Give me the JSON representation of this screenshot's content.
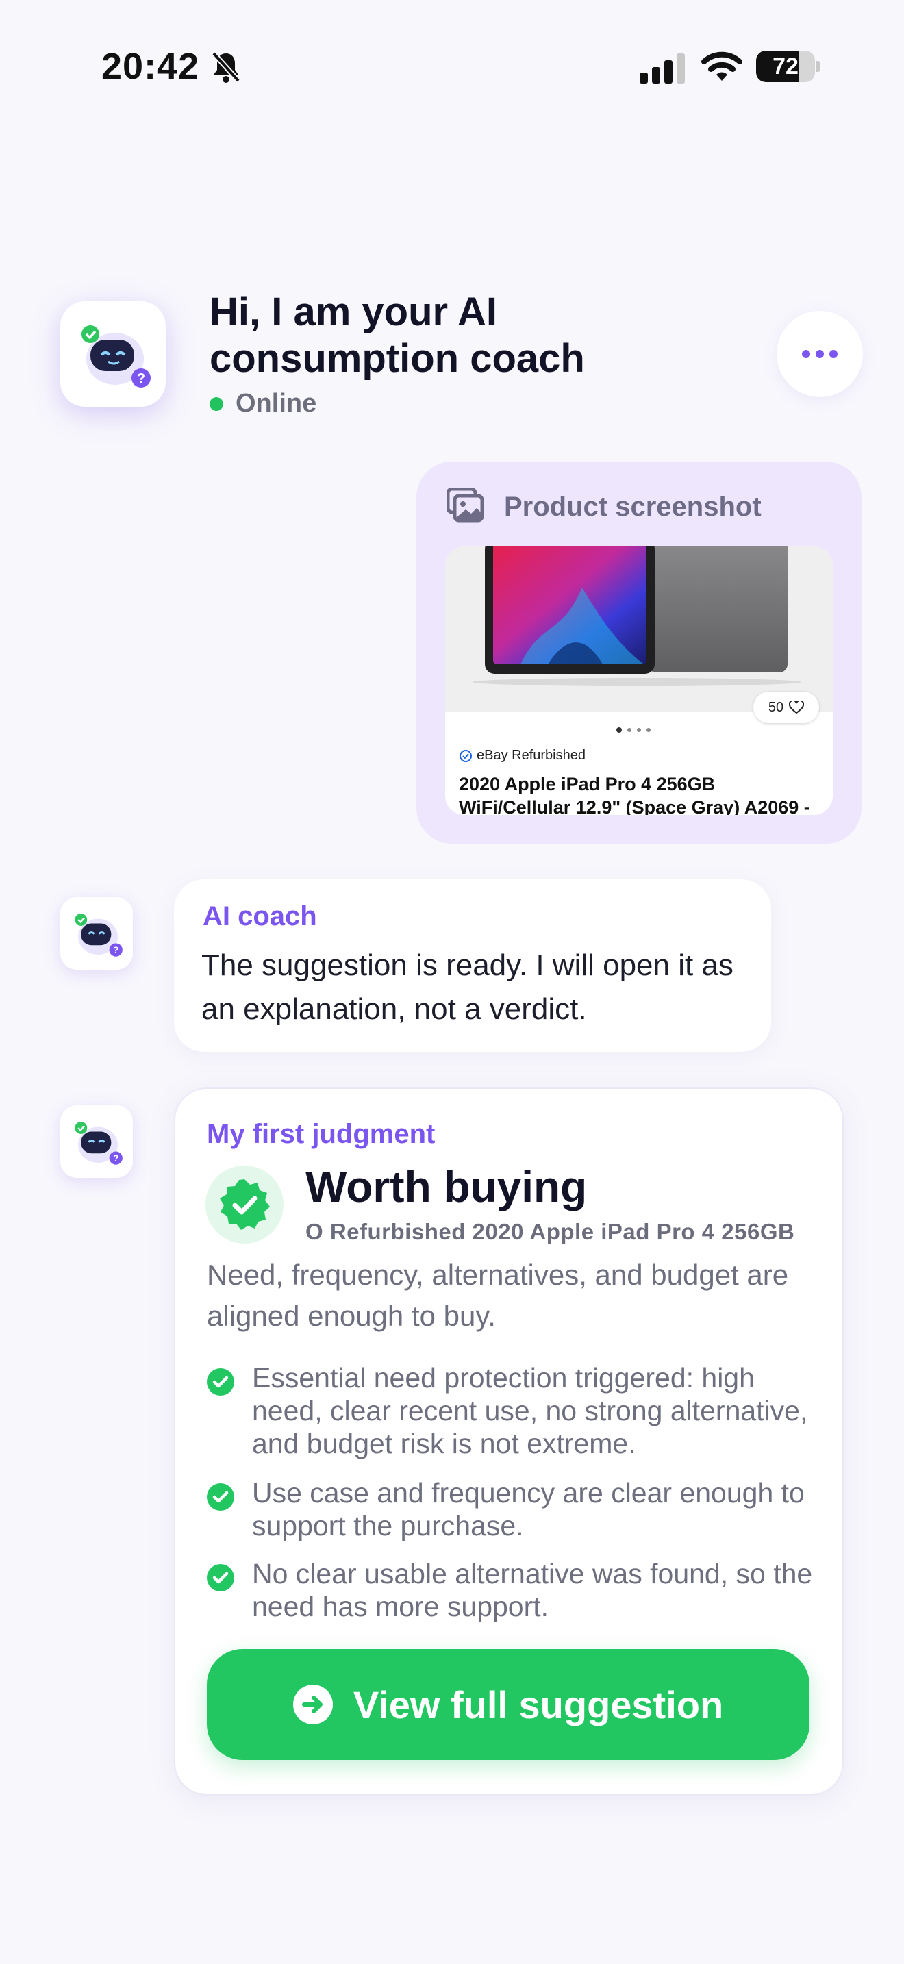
{
  "status_bar": {
    "time": "20:42",
    "icons": [
      "bell-slash-icon",
      "cellular-signal-icon",
      "wifi-icon",
      "battery-icon"
    ],
    "battery_level": "72",
    "battery_fraction": 0.72
  },
  "header": {
    "title": "Hi, I am your AI consumption coach",
    "status": "Online",
    "status_color": "#22c35e",
    "more_icon": "ellipsis-icon"
  },
  "product_shot": {
    "label": "Product screenshot",
    "icon": "images-icon",
    "like_count": "50",
    "seller": "eBay Refurbished",
    "listing_title": "2020 Apple iPad Pro 4 256GB WiFi/Cellular 12.9\" (Space Gray) A2069 -"
  },
  "coach_message": {
    "sender": "AI coach",
    "text": "The suggestion is ready. I will open it as an explanation, not a verdict."
  },
  "judgment": {
    "label": "My first judgment",
    "verdict": "Worth buying",
    "product": "O Refurbished 2020 Apple iPad Pro 4 256GB",
    "summary": "Need, frequency, alternatives, and budget are aligned enough to buy.",
    "reasons": [
      "Essential need protection triggered: high need, clear recent use, no strong alternative, and budget risk is not extreme.",
      "Use case and frequency are clear enough to support the purchase.",
      "No clear usable alternative was found, so the need has more support."
    ],
    "cta_label": "View full suggestion",
    "accent_color": "#7a55f0",
    "success_color": "#22c762"
  }
}
